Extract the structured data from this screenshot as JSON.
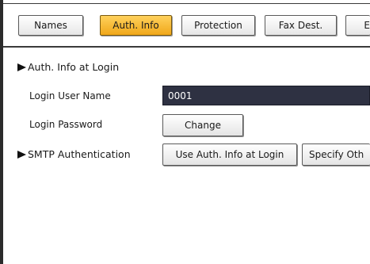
{
  "tabs": [
    {
      "label": "Names",
      "active": false
    },
    {
      "label": "Auth. Info",
      "active": true
    },
    {
      "label": "Protection",
      "active": false
    },
    {
      "label": "Fax Dest.",
      "active": false
    },
    {
      "label": "E",
      "active": false
    }
  ],
  "auth_info_at_login": {
    "heading": "Auth. Info at Login",
    "user_name_label": "Login User Name",
    "user_name_value": "0001",
    "password_label": "Login Password",
    "password_button": "Change"
  },
  "smtp_auth": {
    "heading": "SMTP Authentication",
    "use_auth_button": "Use Auth. Info at Login",
    "specify_other_button": "Specify Oth"
  },
  "colors": {
    "active_tab": "#f5b72a",
    "field_bg": "#2e3142",
    "frame": "#2b2b2b"
  }
}
